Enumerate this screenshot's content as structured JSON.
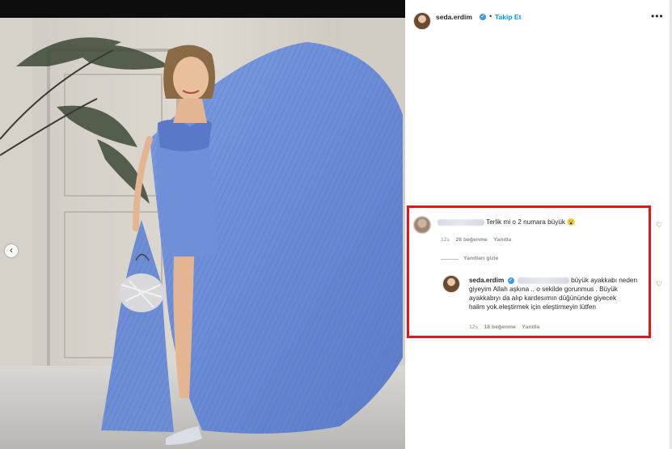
{
  "post": {
    "username": "seda.erdim",
    "follow_label": "Takip Et",
    "separator": "•",
    "more_label": "•••"
  },
  "comments": [
    {
      "text": "Terlik mi o 2 numara büyük 😮",
      "time": "12s",
      "likes": "26 beğenme",
      "reply_label": "Yanıtla"
    }
  ],
  "replies_toggle": "Yanıtları gizle",
  "reply": {
    "username": "seda.erdim",
    "line1": "büyük ayakkabı neden",
    "line2": "giyeyim Allah aşkına .. o sekilde gorunmus . Büyük",
    "line3": "ayakkabıyı da alıp kardesımın düğününde giyecek",
    "line4": "halim yok.eleştirmek için eleştirmeyin lütfen",
    "time": "12s",
    "likes": "18 beğenme",
    "reply_label": "Yanıtla"
  },
  "colors": {
    "dress": "#6f8fd8",
    "highlight": "#e0171d",
    "link": "#0095f6"
  },
  "icons": {
    "carousel_prev": "‹",
    "heart": "♡"
  }
}
